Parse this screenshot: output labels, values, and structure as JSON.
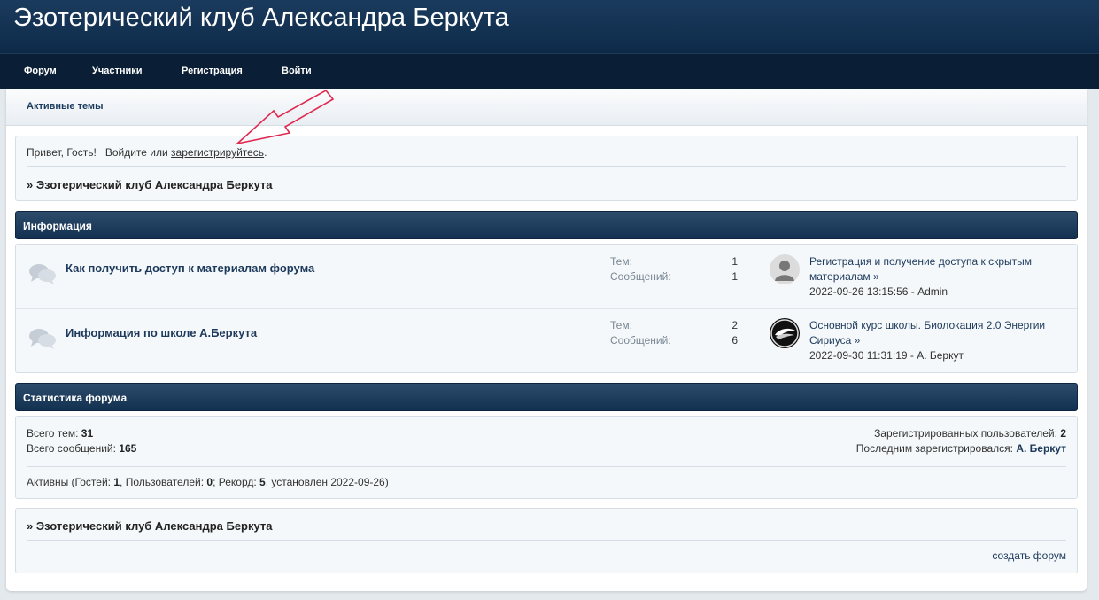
{
  "site": {
    "title": "Эзотерический клуб Александра Беркута"
  },
  "nav": {
    "forum": "Форум",
    "members": "Участники",
    "register": "Регистрация",
    "login": "Войти"
  },
  "subnav": {
    "active_topics": "Активные темы"
  },
  "welcome": {
    "greeting": "Привет, Гость!",
    "text_before": "Войдите или",
    "register_link": "зарегистрируйтесь",
    "text_after": ".",
    "breadcrumb": "» Эзотерический клуб Александра Беркута"
  },
  "category": {
    "title": "Информация",
    "forums": [
      {
        "name": "Как получить доступ к материалам форума",
        "topics_label": "Тем:",
        "posts_label": "Сообщений:",
        "topics": "1",
        "posts": "1",
        "last_post_title": "Регистрация и получение доступа к скрытым материалам »",
        "last_post_meta": "2022-09-26 13:15:56 - Admin",
        "avatar": "default-user-avatar"
      },
      {
        "name": "Информация по школе А.Беркута",
        "topics_label": "Тем:",
        "posts_label": "Сообщений:",
        "topics": "2",
        "posts": "6",
        "last_post_title": "Основной курс школы. Биолокация 2.0 Энергии Сириуса »",
        "last_post_meta": "2022-09-30 11:31:19 - А. Беркут",
        "avatar": "wing-logo-avatar"
      }
    ]
  },
  "stats": {
    "title": "Статистика форума",
    "total_topics_label": "Всего тем:",
    "total_topics": "31",
    "total_posts_label": "Всего сообщений:",
    "total_posts": "165",
    "registered_label": "Зарегистрированных пользователей:",
    "registered": "2",
    "last_registered_label": "Последним зарегистрировался:",
    "last_registered": "А. Беркут",
    "online": {
      "prefix": "Активны (Гостей:",
      "guests": "1",
      "users_label": ", Пользователей:",
      "users": "0",
      "record_label": "; Рекорд:",
      "record": "5",
      "record_date": ", установлен 2022-09-26)"
    }
  },
  "footer": {
    "breadcrumb": "» Эзотерический клуб Александра Беркута",
    "create_forum": "создать форум"
  },
  "colors": {
    "header": "#0d2a48",
    "navbar": "#0a1f36",
    "category_bar": "#1b3b5e",
    "annotation_arrow": "#e0284f"
  }
}
